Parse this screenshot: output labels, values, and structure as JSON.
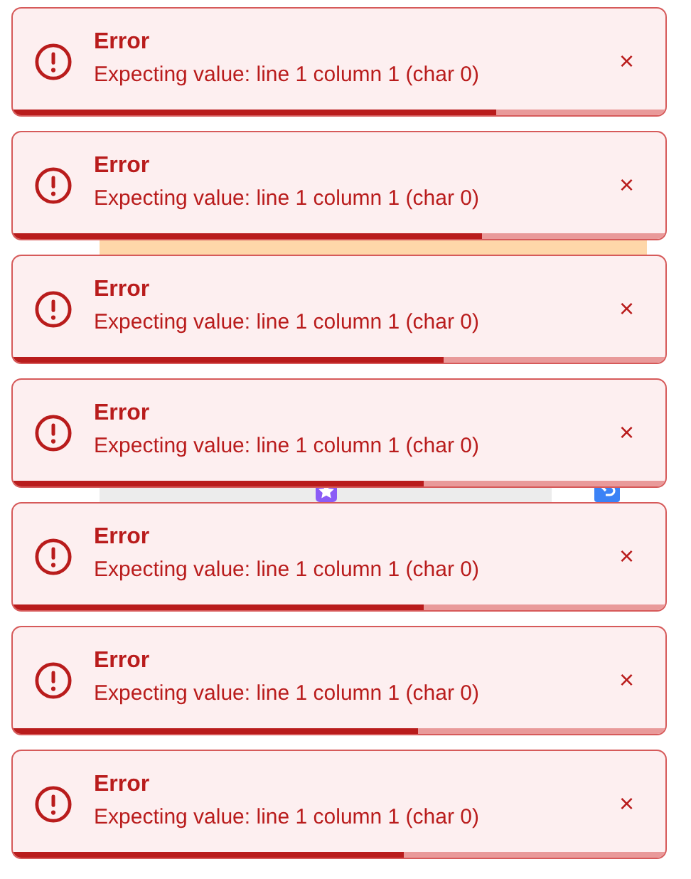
{
  "toasts": [
    {
      "title": "Error",
      "message": "Expecting value: line 1 column 1 (char 0)",
      "close": "×",
      "level": 0.74
    },
    {
      "title": "Error",
      "message": "Expecting value: line 1 column 1 (char 0)",
      "close": "×",
      "level": 0.72
    },
    {
      "title": "Error",
      "message": "Expecting value: line 1 column 1 (char 0)",
      "close": "×",
      "level": 0.66
    },
    {
      "title": "Error",
      "message": "Expecting value: line 1 column 1 (char 0)",
      "close": "×",
      "level": 0.63
    },
    {
      "title": "Error",
      "message": "Expecting value: line 1 column 1 (char 0)",
      "close": "×",
      "level": 0.63
    },
    {
      "title": "Error",
      "message": "Expecting value: line 1 column 1 (char 0)",
      "close": "×",
      "level": 0.62
    },
    {
      "title": "Error",
      "message": "Expecting value: line 1 column 1 (char 0)",
      "close": "×",
      "level": 0.6
    }
  ]
}
